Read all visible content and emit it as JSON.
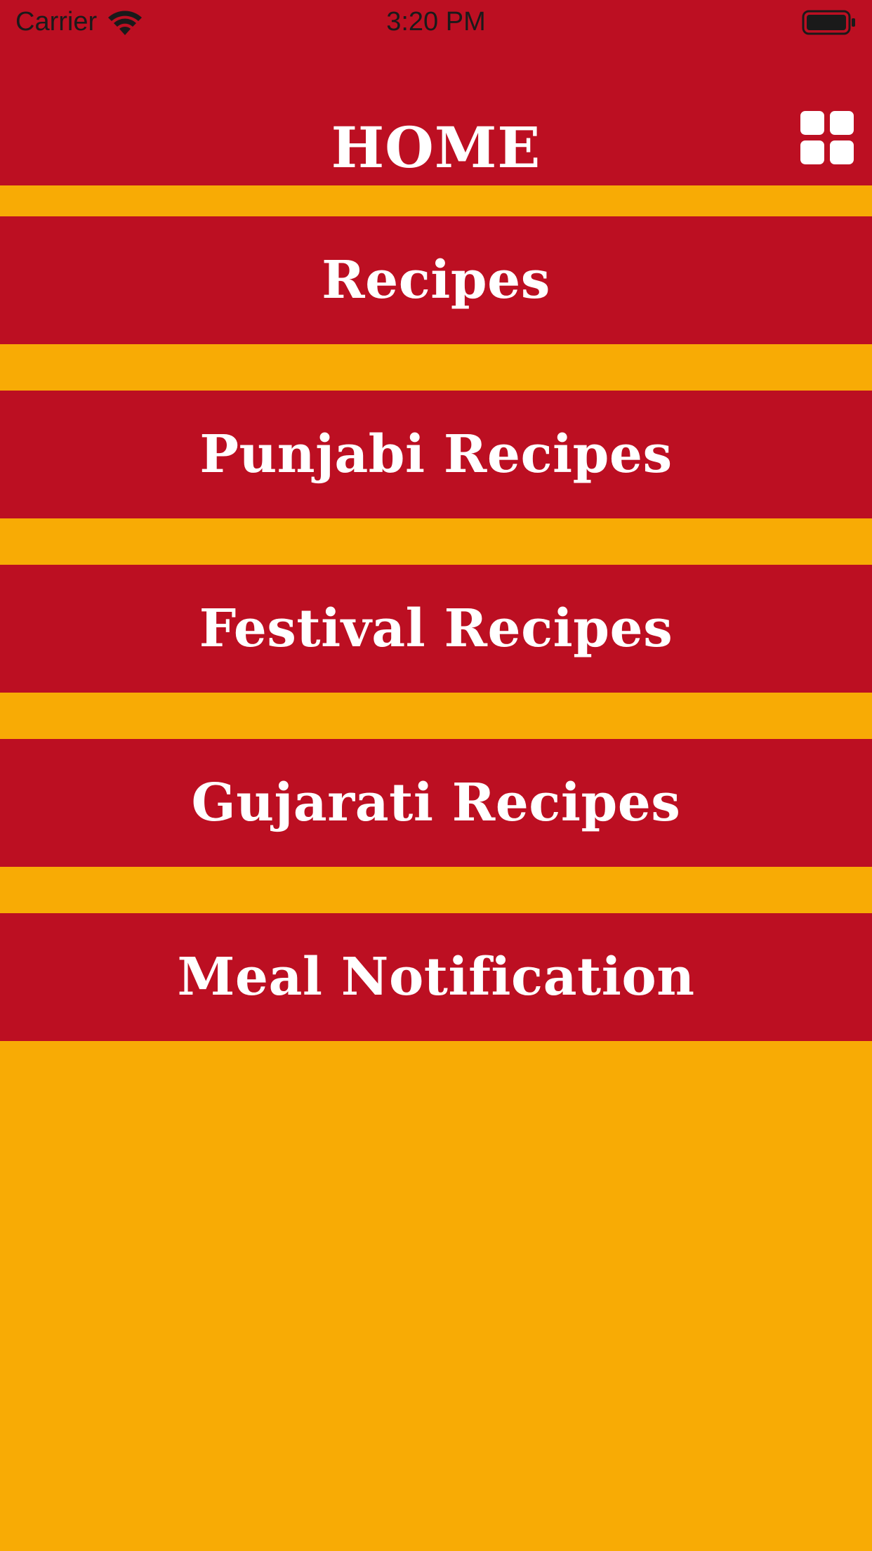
{
  "colors": {
    "primary": "#BC0F22",
    "background": "#F8AB05",
    "text": "#FFFFFF"
  },
  "status_bar": {
    "carrier": "Carrier",
    "time": "3:20 PM"
  },
  "nav": {
    "title": "HOME",
    "menu_icon": "grid-icon"
  },
  "menu": {
    "items": [
      {
        "label": "Recipes"
      },
      {
        "label": "Punjabi Recipes"
      },
      {
        "label": "Festival Recipes"
      },
      {
        "label": "Gujarati Recipes"
      },
      {
        "label": "Meal Notification"
      }
    ]
  }
}
